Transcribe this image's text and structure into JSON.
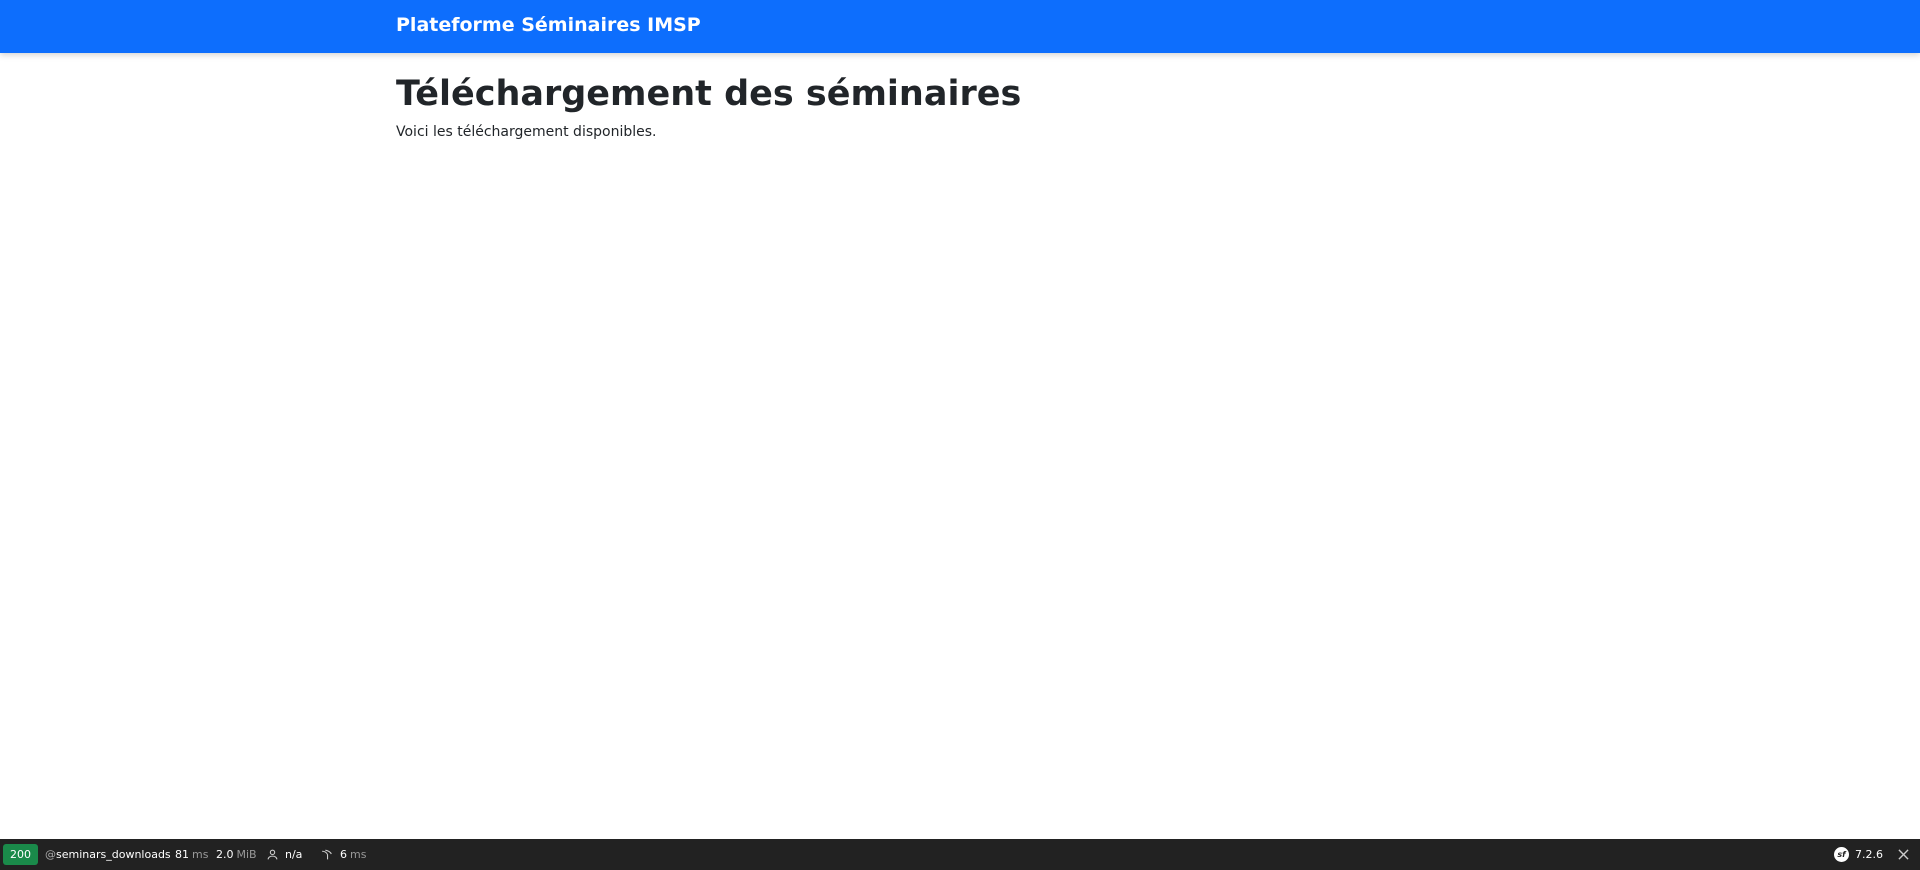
{
  "navbar": {
    "brand": "Plateforme Séminaires IMSP"
  },
  "main": {
    "title": "Téléchargement des séminaires",
    "subtitle": "Voici les téléchargement disponibles."
  },
  "toolbar": {
    "status_code": "200",
    "route_prefix": "@",
    "route": "seminars_downloads",
    "time_value": "81",
    "time_unit": "ms",
    "memory_value": "2.0",
    "memory_unit": "MiB",
    "user": "n/a",
    "twig_value": "6",
    "twig_unit": "ms",
    "symfony_version": "7.2.6",
    "icons": {
      "user": "user-icon",
      "twig": "twig-icon",
      "symfony": "symfony-logo-icon",
      "close": "close-icon"
    },
    "colors": {
      "background": "#222222",
      "status_success": "#1a8a4a"
    }
  },
  "colors": {
    "navbar": "#0d6efd"
  }
}
